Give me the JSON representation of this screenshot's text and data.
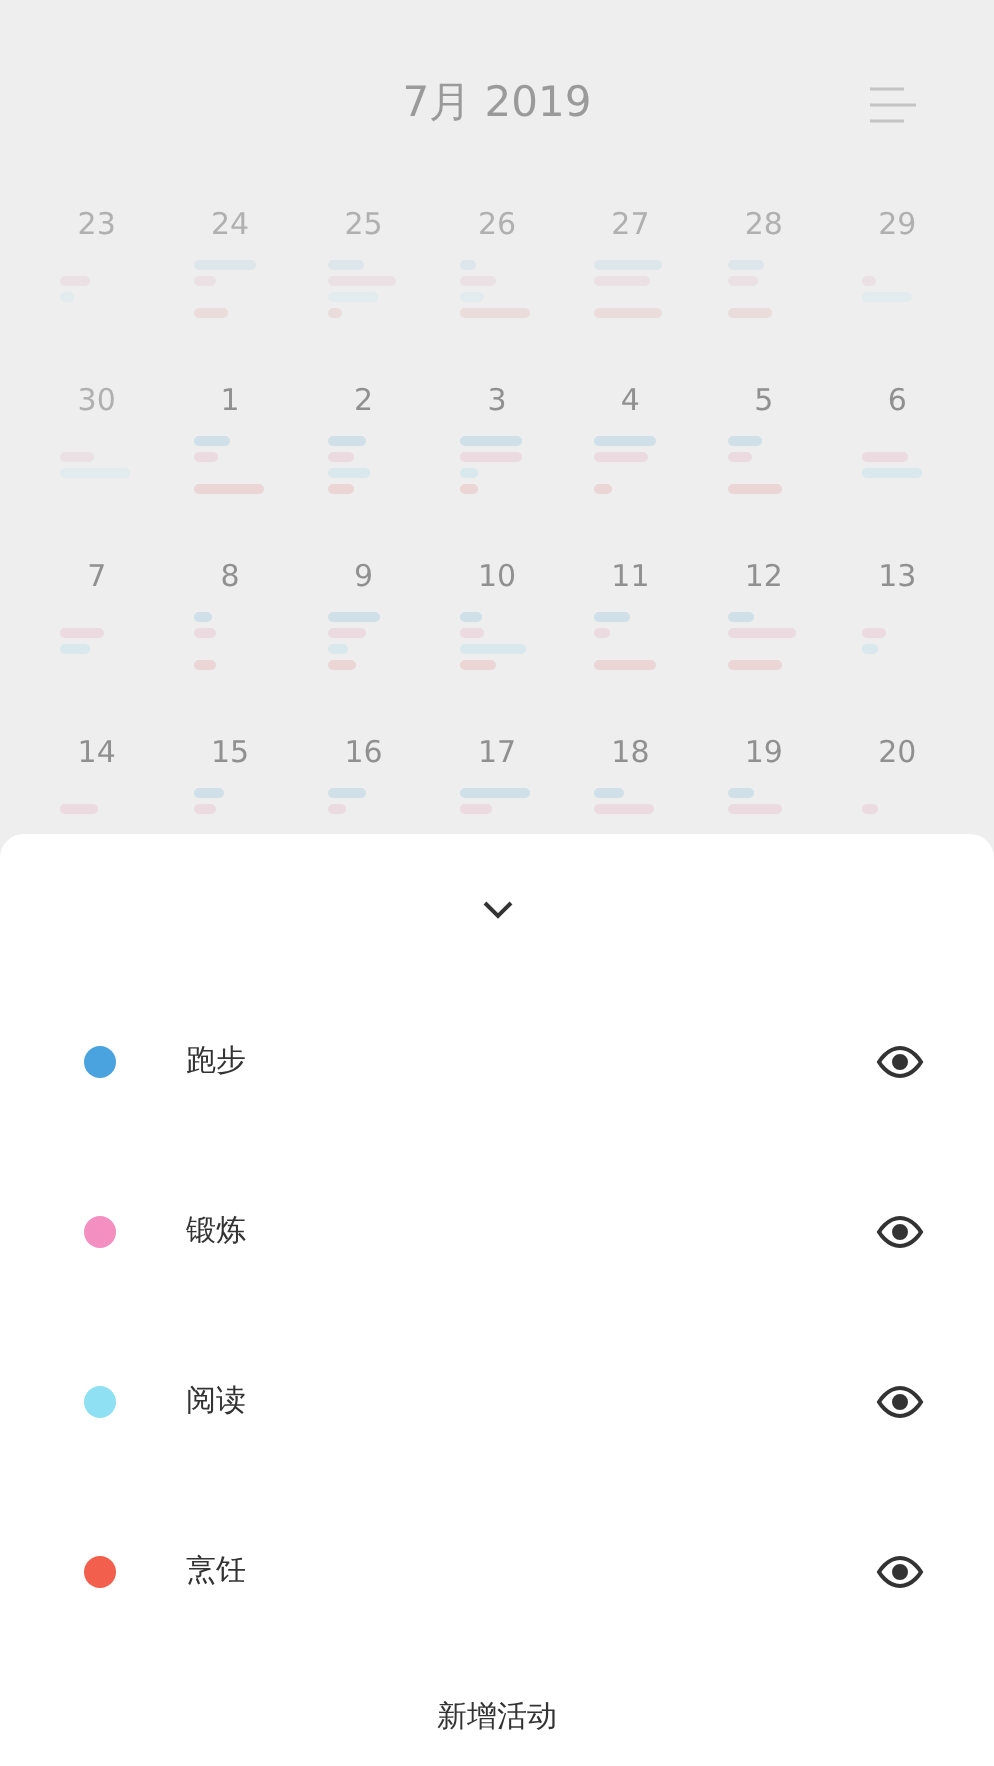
{
  "header": {
    "title": "7月 2019"
  },
  "calendar": {
    "weeks": [
      {
        "days": [
          {
            "date": "23",
            "other_month": true,
            "events": [
              {
                "kind": "gap"
              },
              {
                "kind": "bar",
                "color": "#ebe1e4"
              },
              {
                "kind": "bar",
                "color": "#e2ebed"
              }
            ]
          },
          {
            "date": "24",
            "other_month": true,
            "events": [
              {
                "kind": "bar",
                "color": "#dde7eb"
              },
              {
                "kind": "bar",
                "color": "#ebe1e4"
              },
              {
                "kind": "gap"
              },
              {
                "kind": "bar",
                "color": "#ebdcdc"
              }
            ]
          },
          {
            "date": "25",
            "other_month": true,
            "events": [
              {
                "kind": "bar",
                "color": "#dde7eb"
              },
              {
                "kind": "bar",
                "color": "#ebe1e4"
              },
              {
                "kind": "bar",
                "color": "#e2ebed"
              },
              {
                "kind": "bar",
                "color": "#ebdcdc"
              }
            ]
          },
          {
            "date": "26",
            "other_month": true,
            "events": [
              {
                "kind": "bar",
                "color": "#dde7eb"
              },
              {
                "kind": "bar",
                "color": "#ebe1e4"
              },
              {
                "kind": "bar",
                "color": "#e2ebed"
              },
              {
                "kind": "bar",
                "color": "#ebdcdc"
              }
            ]
          },
          {
            "date": "27",
            "other_month": true,
            "events": [
              {
                "kind": "bar",
                "color": "#dde7eb"
              },
              {
                "kind": "bar",
                "color": "#ebe1e4"
              },
              {
                "kind": "gap"
              },
              {
                "kind": "bar",
                "color": "#ebdcdc"
              }
            ]
          },
          {
            "date": "28",
            "other_month": true,
            "events": [
              {
                "kind": "bar",
                "color": "#dde7eb"
              },
              {
                "kind": "bar",
                "color": "#ebe1e4"
              },
              {
                "kind": "gap"
              },
              {
                "kind": "bar",
                "color": "#ebdcdc"
              }
            ]
          },
          {
            "date": "29",
            "other_month": true,
            "events": [
              {
                "kind": "gap"
              },
              {
                "kind": "bar",
                "color": "#ebe1e4"
              },
              {
                "kind": "bar",
                "color": "#e2ebed"
              }
            ]
          }
        ]
      },
      {
        "days": [
          {
            "date": "30",
            "other_month": true,
            "events": [
              {
                "kind": "gap"
              },
              {
                "kind": "bar",
                "color": "#ebe1e4"
              },
              {
                "kind": "bar",
                "color": "#e2ebed"
              }
            ]
          },
          {
            "date": "1",
            "other_month": false,
            "events": [
              {
                "kind": "bar",
                "color": "#cfe0e8"
              },
              {
                "kind": "bar",
                "color": "#ebdbe1"
              },
              {
                "kind": "gap"
              },
              {
                "kind": "bar",
                "color": "#ecd5d5"
              }
            ]
          },
          {
            "date": "2",
            "other_month": false,
            "events": [
              {
                "kind": "bar",
                "color": "#cfe0e8"
              },
              {
                "kind": "bar",
                "color": "#ebdbe1"
              },
              {
                "kind": "bar",
                "color": "#d9e8ed"
              },
              {
                "kind": "bar",
                "color": "#ecd5d5"
              }
            ]
          },
          {
            "date": "3",
            "other_month": false,
            "events": [
              {
                "kind": "bar",
                "color": "#cfe0e8"
              },
              {
                "kind": "bar",
                "color": "#ebdbe1"
              },
              {
                "kind": "bar",
                "color": "#d9e8ed"
              },
              {
                "kind": "bar",
                "color": "#ecd5d5"
              }
            ]
          },
          {
            "date": "4",
            "other_month": false,
            "events": [
              {
                "kind": "bar",
                "color": "#cfe0e8"
              },
              {
                "kind": "bar",
                "color": "#ebdbe1"
              },
              {
                "kind": "gap"
              },
              {
                "kind": "bar",
                "color": "#ecd5d5"
              }
            ]
          },
          {
            "date": "5",
            "other_month": false,
            "events": [
              {
                "kind": "bar",
                "color": "#cfe0e8"
              },
              {
                "kind": "bar",
                "color": "#ebdbe1"
              },
              {
                "kind": "gap"
              },
              {
                "kind": "bar",
                "color": "#ecd5d5"
              }
            ]
          },
          {
            "date": "6",
            "other_month": false,
            "events": [
              {
                "kind": "gap"
              },
              {
                "kind": "bar",
                "color": "#ebdbe1"
              },
              {
                "kind": "bar",
                "color": "#d9e8ed"
              }
            ]
          }
        ]
      },
      {
        "days": [
          {
            "date": "7",
            "other_month": false,
            "events": [
              {
                "kind": "gap"
              },
              {
                "kind": "bar",
                "color": "#ebdbe1"
              },
              {
                "kind": "bar",
                "color": "#d9e8ed"
              }
            ]
          },
          {
            "date": "8",
            "other_month": false,
            "events": [
              {
                "kind": "bar",
                "color": "#cfe0e8"
              },
              {
                "kind": "bar",
                "color": "#ebdbe1"
              },
              {
                "kind": "gap"
              },
              {
                "kind": "bar",
                "color": "#ecd5d5"
              }
            ]
          },
          {
            "date": "9",
            "other_month": false,
            "events": [
              {
                "kind": "bar",
                "color": "#cfe0e8"
              },
              {
                "kind": "bar",
                "color": "#ebdbe1"
              },
              {
                "kind": "bar",
                "color": "#d9e8ed"
              },
              {
                "kind": "bar",
                "color": "#ecd5d5"
              }
            ]
          },
          {
            "date": "10",
            "other_month": false,
            "events": [
              {
                "kind": "bar",
                "color": "#cfe0e8"
              },
              {
                "kind": "bar",
                "color": "#ebdbe1"
              },
              {
                "kind": "bar",
                "color": "#d9e8ed"
              },
              {
                "kind": "bar",
                "color": "#ecd5d5"
              }
            ]
          },
          {
            "date": "11",
            "other_month": false,
            "events": [
              {
                "kind": "bar",
                "color": "#cfe0e8"
              },
              {
                "kind": "bar",
                "color": "#ebdbe1"
              },
              {
                "kind": "gap"
              },
              {
                "kind": "bar",
                "color": "#ecd5d5"
              }
            ]
          },
          {
            "date": "12",
            "other_month": false,
            "events": [
              {
                "kind": "bar",
                "color": "#cfe0e8"
              },
              {
                "kind": "bar",
                "color": "#ebdbe1"
              },
              {
                "kind": "gap"
              },
              {
                "kind": "bar",
                "color": "#ecd5d5"
              }
            ]
          },
          {
            "date": "13",
            "other_month": false,
            "events": [
              {
                "kind": "gap"
              },
              {
                "kind": "bar",
                "color": "#ebdbe1"
              },
              {
                "kind": "bar",
                "color": "#d9e8ed"
              }
            ]
          }
        ]
      },
      {
        "days": [
          {
            "date": "14",
            "other_month": false,
            "events": [
              {
                "kind": "gap"
              },
              {
                "kind": "bar",
                "color": "#ebdbe1"
              }
            ]
          },
          {
            "date": "15",
            "other_month": false,
            "events": [
              {
                "kind": "bar",
                "color": "#cfe0e8"
              },
              {
                "kind": "bar",
                "color": "#ebdbe1"
              }
            ]
          },
          {
            "date": "16",
            "other_month": false,
            "events": [
              {
                "kind": "bar",
                "color": "#cfe0e8"
              },
              {
                "kind": "bar",
                "color": "#ebdbe1"
              }
            ]
          },
          {
            "date": "17",
            "other_month": false,
            "events": [
              {
                "kind": "bar",
                "color": "#cfe0e8"
              },
              {
                "kind": "bar",
                "color": "#ebdbe1"
              }
            ]
          },
          {
            "date": "18",
            "other_month": false,
            "events": [
              {
                "kind": "bar",
                "color": "#cfe0e8"
              },
              {
                "kind": "bar",
                "color": "#ebdbe1"
              }
            ]
          },
          {
            "date": "19",
            "other_month": false,
            "events": [
              {
                "kind": "bar",
                "color": "#cfe0e8"
              },
              {
                "kind": "bar",
                "color": "#ebdbe1"
              }
            ]
          },
          {
            "date": "20",
            "other_month": false,
            "events": [
              {
                "kind": "gap"
              },
              {
                "kind": "bar",
                "color": "#ebdbe1"
              }
            ]
          }
        ]
      }
    ]
  },
  "sheet": {
    "activities": [
      {
        "name": "跑步",
        "color": "#4aa3df",
        "visible": true
      },
      {
        "name": "锻炼",
        "color": "#f48fc1",
        "visible": true
      },
      {
        "name": "阅读",
        "color": "#8ee0f2",
        "visible": true
      },
      {
        "name": "烹饪",
        "color": "#f25f4c",
        "visible": true
      }
    ],
    "add_button": "新增活动"
  }
}
